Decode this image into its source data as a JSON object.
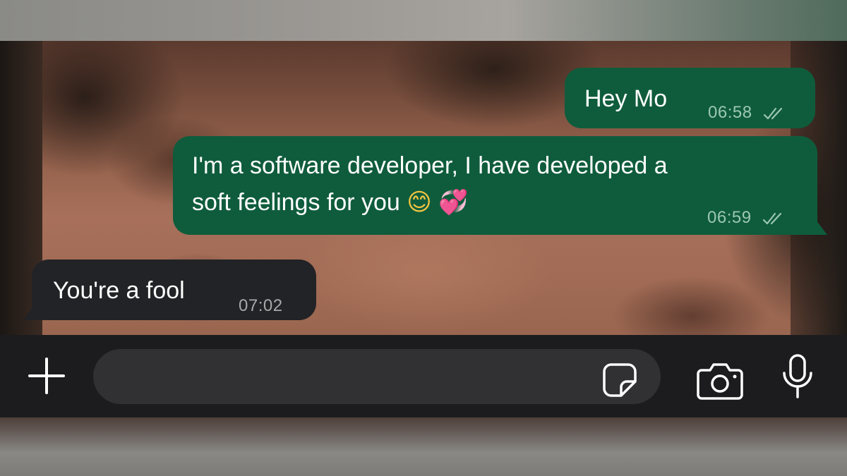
{
  "chat": {
    "messages": [
      {
        "direction": "outgoing",
        "text": "Hey Mo",
        "time": "06:58",
        "status_icon": "double-check-icon"
      },
      {
        "direction": "outgoing",
        "line1": "I'm a software developer, I have developed a",
        "line2": "soft feelings for you",
        "emojis": [
          "😊",
          "💞"
        ],
        "time": "06:59",
        "status_icon": "double-check-icon"
      },
      {
        "direction": "incoming",
        "text": "You're a fool",
        "time": "07:02"
      }
    ]
  },
  "composer": {
    "input_value": "",
    "icons": [
      "plus-icon",
      "sticker-icon",
      "camera-icon",
      "microphone-icon"
    ]
  },
  "colors": {
    "outgoing_bubble": "#0f5c3c",
    "incoming_bubble": "#222326",
    "composer_bg": "#1c1c1e",
    "input_bg": "#313134"
  }
}
